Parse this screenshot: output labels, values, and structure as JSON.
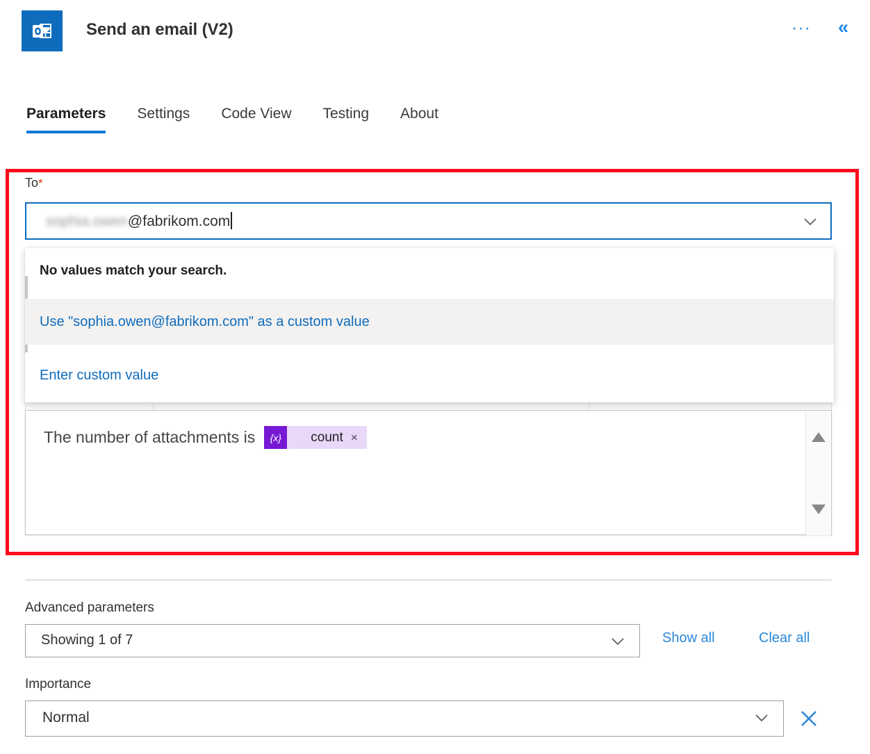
{
  "header": {
    "app_icon": "outlook-icon",
    "title": "Send an email (V2)",
    "ellipsis": "···",
    "collapse": "«"
  },
  "tabs": [
    {
      "label": "Parameters",
      "active": true
    },
    {
      "label": "Settings",
      "active": false
    },
    {
      "label": "Code View",
      "active": false
    },
    {
      "label": "Testing",
      "active": false
    },
    {
      "label": "About",
      "active": false
    }
  ],
  "to_field": {
    "label": "To",
    "required_marker": "*",
    "value_blurred": "sophia.owen",
    "value_visible": "@fabrikom.com",
    "full_value": "sophia.owen@fabrikom.com",
    "chevron": "chevron-down-icon"
  },
  "dropdown": {
    "no_match_message": "No values match your search.",
    "items": [
      {
        "label": "Use \"sophia.owen@fabrikom.com\" as a custom value",
        "highlighted": true
      },
      {
        "label": "Enter custom value",
        "highlighted": false
      }
    ]
  },
  "body_editor": {
    "text": "The number of attachments is",
    "token_glyph": "{x}",
    "token_label": "count",
    "token_remove": "×",
    "scroll_up": "triangle-up-icon",
    "scroll_down": "triangle-down-icon"
  },
  "advanced": {
    "label": "Advanced parameters",
    "showing_value": "Showing 1 of 7",
    "show_all": "Show all",
    "clear_all": "Clear all"
  },
  "importance": {
    "label": "Importance",
    "value": "Normal",
    "clear_icon": "close-icon"
  },
  "colors": {
    "accent": "#0f6cbd",
    "link": "#2b88d8",
    "annotation": "#fc0d1b",
    "token": "#7719d4",
    "required": "#d83b01"
  }
}
